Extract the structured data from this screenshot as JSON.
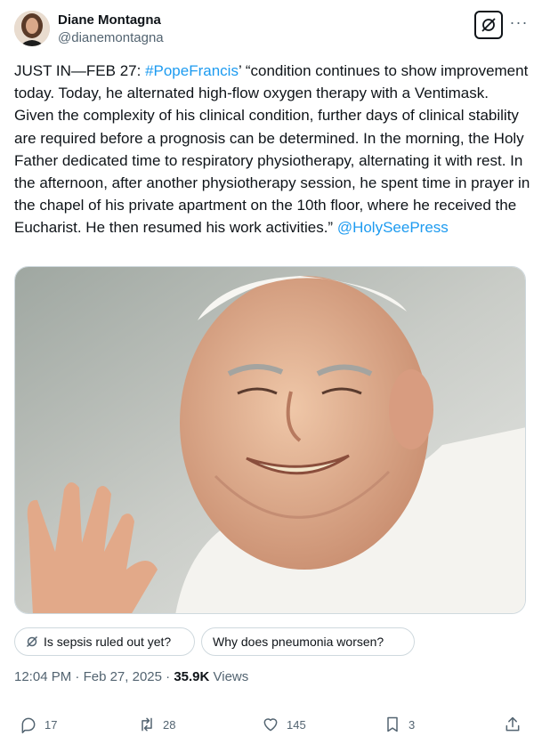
{
  "author": {
    "display_name": "Diane Montagna",
    "handle": "@dianemontagna"
  },
  "tweet": {
    "prefix": "JUST IN—FEB 27: ",
    "hashtag": "#PopeFrancis",
    "body": "’ “condition continues to show improvement today. Today, he alternated high-flow oxygen therapy with a Ventimask. Given the complexity of his clinical condition, further days of clinical stability are required before a prognosis can be determined. In the morning, the Holy Father dedicated time to respiratory physiotherapy, alternating it with rest. In the afternoon, after another physiotherapy session, he spent time in prayer in the chapel of his private apartment on the 10th floor, where he received the Eucharist. He then resumed his work activities.” ",
    "mention": "@HolySeePress"
  },
  "suggestions": {
    "q1": "Is sepsis ruled out yet?",
    "q2": "Why does pneumonia worsen?"
  },
  "meta": {
    "time": "12:04 PM",
    "sep1": " · ",
    "date": "Feb 27, 2025",
    "sep2": " · ",
    "views_count": "35.9K",
    "views_label": " Views"
  },
  "actions": {
    "replies": "17",
    "reposts": "28",
    "likes": "145",
    "bookmarks": "3"
  },
  "colors": {
    "link": "#1d9bf0",
    "secondary_text": "#536471",
    "border": "#cfd9de"
  },
  "icons": [
    "grok-icon",
    "more-icon",
    "reply-icon",
    "repost-icon",
    "like-icon",
    "bookmark-icon",
    "share-icon",
    "grok-small-icon"
  ]
}
